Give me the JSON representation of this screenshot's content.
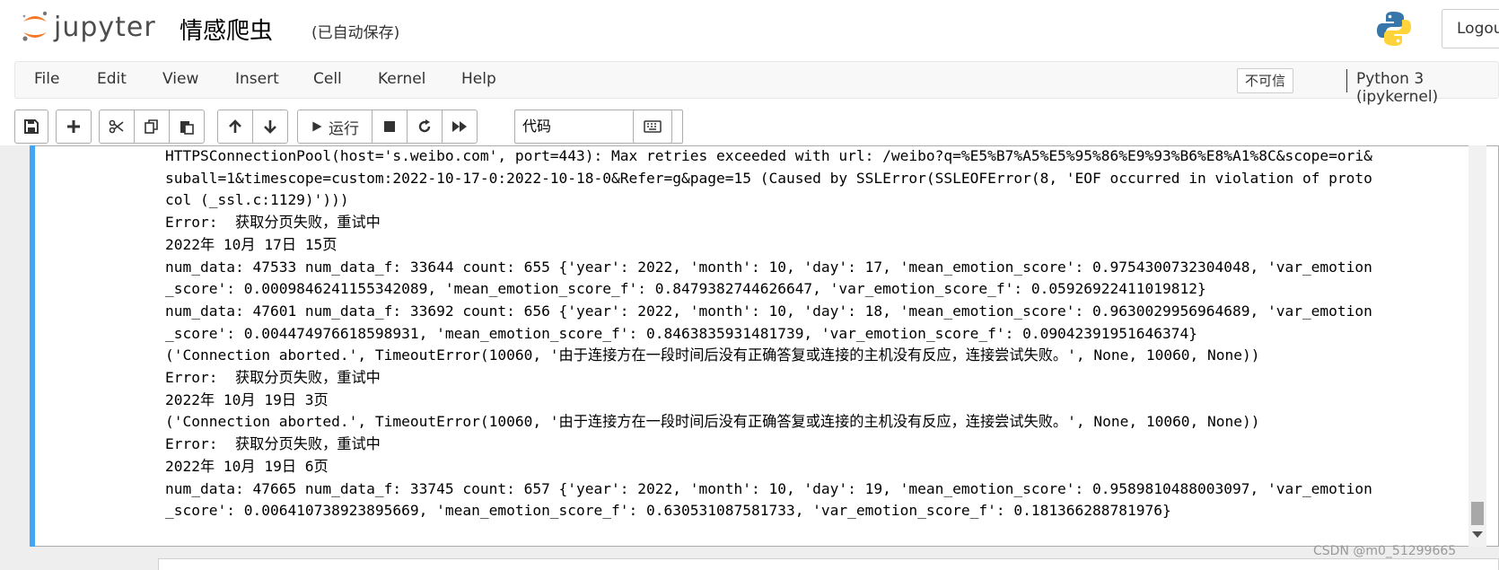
{
  "header": {
    "brand": "jupyter",
    "notebook_name": "情感爬虫",
    "checkpoint_status": "(已自动保存)",
    "logout_label": "Logout"
  },
  "menubar": {
    "items": [
      "File",
      "Edit",
      "View",
      "Insert",
      "Cell",
      "Kernel",
      "Help"
    ],
    "trusted_label": "不可信",
    "kernel_label": "Python 3 (ipykernel)"
  },
  "toolbar": {
    "run_label": "运行",
    "cell_type": "代码"
  },
  "output": {
    "lines": [
      "HTTPSConnectionPool(host='s.weibo.com', port=443): Max retries exceeded with url: /weibo?q=%E5%B7%A5%E5%95%86%E9%93%B6%E8%A1%8C&scope=ori&",
      "suball=1&timescope=custom:2022-10-17-0:2022-10-18-0&Refer=g&page=15 (Caused by SSLError(SSLEOFError(8, 'EOF occurred in violation of proto",
      "col (_ssl.c:1129)')))",
      "Error:  获取分页失败，重试中",
      "2022年 10月 17日 15页",
      "num_data: 47533 num_data_f: 33644 count: 655 {'year': 2022, 'month': 10, 'day': 17, 'mean_emotion_score': 0.9754300732304048, 'var_emotion",
      "_score': 0.0009846241155342089, 'mean_emotion_score_f': 0.8479382744626647, 'var_emotion_score_f': 0.05926922411019812}",
      "num_data: 47601 num_data_f: 33692 count: 656 {'year': 2022, 'month': 10, 'day': 18, 'mean_emotion_score': 0.9630029956964689, 'var_emotion",
      "_score': 0.004474976618598931, 'mean_emotion_score_f': 0.8463835931481739, 'var_emotion_score_f': 0.09042391951646374}",
      "('Connection aborted.', TimeoutError(10060, '由于连接方在一段时间后没有正确答复或连接的主机没有反应，连接尝试失败。', None, 10060, None))",
      "Error:  获取分页失败，重试中",
      "2022年 10月 19日 3页",
      "('Connection aborted.', TimeoutError(10060, '由于连接方在一段时间后没有正确答复或连接的主机没有反应，连接尝试失败。', None, 10060, None))",
      "Error:  获取分页失败，重试中",
      "2022年 10月 19日 6页",
      "num_data: 47665 num_data_f: 33745 count: 657 {'year': 2022, 'month': 10, 'day': 19, 'mean_emotion_score': 0.9589810488003097, 'var_emotion",
      "_score': 0.006410738923895669, 'mean_emotion_score_f': 0.630531087581733, 'var_emotion_score_f': 0.181366288781976}"
    ]
  },
  "watermark": "CSDN @m0_51299665",
  "colors": {
    "cell_selected": "#42a5f5",
    "notebook_bg": "#eeeeee"
  }
}
